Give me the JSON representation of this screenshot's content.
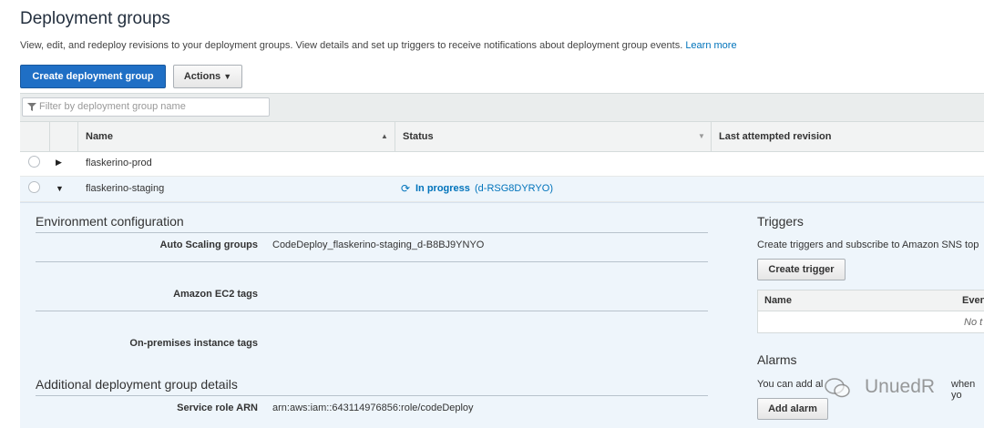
{
  "page": {
    "title": "Deployment groups",
    "description": "View, edit, and redeploy revisions to your deployment groups. View details and set up triggers to receive notifications about deployment group events.",
    "learn_more": "Learn more"
  },
  "toolbar": {
    "create_label": "Create deployment group",
    "actions_label": "Actions"
  },
  "filter": {
    "placeholder": "Filter by deployment group name"
  },
  "table": {
    "columns": [
      "Name",
      "Status",
      "Last attempted revision"
    ],
    "rows": [
      {
        "name": "flaskerino-prod",
        "status": "",
        "deployment_id": "",
        "expanded": false
      },
      {
        "name": "flaskerino-staging",
        "status": "In progress",
        "deployment_id": "(d-RSG8DYRYO)",
        "expanded": true
      }
    ]
  },
  "detail": {
    "env_heading": "Environment configuration",
    "asg_label": "Auto Scaling groups",
    "asg_value": "CodeDeploy_flaskerino-staging_d-B8BJ9YNYO",
    "ec2_label": "Amazon EC2 tags",
    "onprem_label": "On-premises instance tags",
    "additional_heading": "Additional deployment group details",
    "role_label": "Service role ARN",
    "role_value": "arn:aws:iam::643114976856:role/codeDeploy"
  },
  "triggers": {
    "heading": "Triggers",
    "description": "Create triggers and subscribe to Amazon SNS top",
    "create_label": "Create trigger",
    "table_columns": [
      "Name",
      "Even"
    ],
    "empty_text": "No t"
  },
  "alarms": {
    "heading": "Alarms",
    "description": "You can add al",
    "description_end": "when yo",
    "add_label": "Add alarm"
  },
  "watermark": {
    "text": "UnuedR"
  },
  "colors": {
    "primary": "#1f6fc5",
    "link": "#0073bb",
    "expanded_bg": "#eef5fb"
  }
}
